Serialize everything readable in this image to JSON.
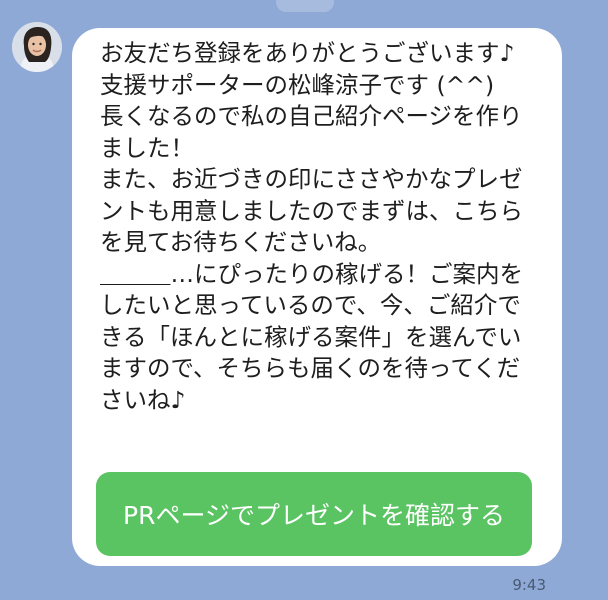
{
  "sender": {
    "avatar_icon": "woman-portrait-avatar"
  },
  "message": {
    "text": "お友だち登録をありがとうございます♪\n支援サポーターの松峰涼子です (^^)\n長くなるので私の自己紹介ページを作りました！\nまた、お近づきの印にささやかなプレゼントも用意しましたのでまずは、こちらを見てお待ちくださいね。\n＿＿＿…にぴったりの稼げる！ご案内をしたいと思っているので、今、ご紹介できる「ほんとに稼げる案件」を選んでいますので、そちらも届くのを待ってくださいね♪",
    "button_label": "PRページでプレゼントを確認する",
    "time": "9:43"
  },
  "colors": {
    "chat_background": "#8fa9d6",
    "bubble": "#ffffff",
    "button": "#5ac463"
  }
}
